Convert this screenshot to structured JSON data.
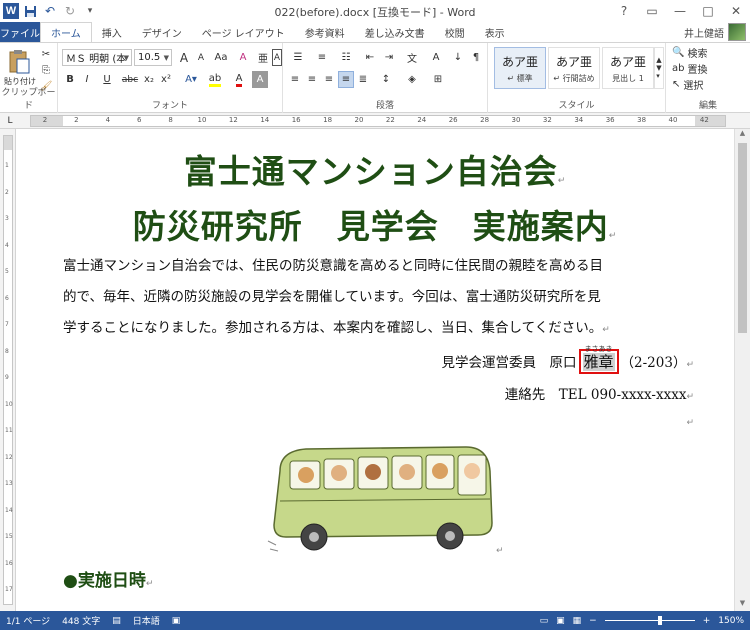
{
  "window": {
    "title": "022(before).docx [互換モード] - Word",
    "app_icon": "W",
    "controls": [
      "?",
      "▭",
      "—",
      "□",
      "✕"
    ]
  },
  "qat": {
    "save_icon": "💾",
    "undo_icon": "↶",
    "redo_icon": "↻",
    "more_icon": "▾"
  },
  "tabs": [
    {
      "label": "ファイル"
    },
    {
      "label": "ホーム"
    },
    {
      "label": "挿入"
    },
    {
      "label": "デザイン"
    },
    {
      "label": "ページ レイアウト"
    },
    {
      "label": "参考資料"
    },
    {
      "label": "差し込み文書"
    },
    {
      "label": "校閲"
    },
    {
      "label": "表示"
    }
  ],
  "user": {
    "name": "井上健語"
  },
  "ribbon": {
    "clipboard": {
      "label": "クリップボード",
      "paste_label": "貼り付け"
    },
    "font": {
      "label": "フォント",
      "font_name": "ＭＳ 明朝 (本",
      "font_size": "10.5",
      "bold": "B",
      "italic": "I",
      "underline": "U",
      "strike": "abc",
      "subscript": "x₂",
      "superscript": "x²",
      "grow": "A",
      "shrink": "A",
      "case": "Aa",
      "clear": "A",
      "phonetic": "亜",
      "border": "A"
    },
    "paragraph": {
      "label": "段落"
    },
    "styles": {
      "label": "スタイル",
      "items": [
        {
          "sample": "あア亜",
          "name": "↵ 標準"
        },
        {
          "sample": "あア亜",
          "name": "↵ 行間詰め"
        },
        {
          "sample": "あア亜",
          "name": "見出し 1"
        }
      ]
    },
    "editing": {
      "label": "編集",
      "search": "検索",
      "replace": "置換",
      "select": "選択"
    }
  },
  "ruler_numbers": [
    "2",
    "2",
    "4",
    "6",
    "8",
    "10",
    "12",
    "14",
    "16",
    "18",
    "20",
    "22",
    "24",
    "26",
    "28",
    "30",
    "32",
    "34",
    "36",
    "38",
    "40",
    "42"
  ],
  "vruler_numbers": [
    "1",
    "2",
    "3",
    "4",
    "5",
    "6",
    "7",
    "8",
    "9",
    "10",
    "11",
    "12",
    "13",
    "14",
    "15",
    "16",
    "17"
  ],
  "document": {
    "title_line1": "富士通マンション自治会",
    "title_line2": "防災研究所　見学会　実施案内",
    "body_line1": "富士通マンション自治会では、住民の防災意識を高めると同時に住民間の親睦を高める目",
    "body_line2": "的で、毎年、近隣の防災施設の見学会を開催しています。今回は、富士通防災研究所を見",
    "body_line3": "学することになりました。参加される方は、本案内を確認し、当日、集合してください。",
    "committee_prefix": "見学会運営委員　原口",
    "committee_name": "雅章",
    "committee_ruby": "まさあき",
    "committee_room": "（2-203）",
    "contact": "連絡先　TEL 090-xxxx-xxxx",
    "heading_bottom": "●実施日時",
    "return_mark": "↵"
  },
  "statusbar": {
    "page": "1/1 ページ",
    "words": "448 文字",
    "language": "日本語",
    "zoom": "150%",
    "zoom_fraction": 0.62
  },
  "colors": {
    "accent": "#2b579a",
    "title_green": "#1f4e14",
    "highlight_red": "#e01010"
  }
}
